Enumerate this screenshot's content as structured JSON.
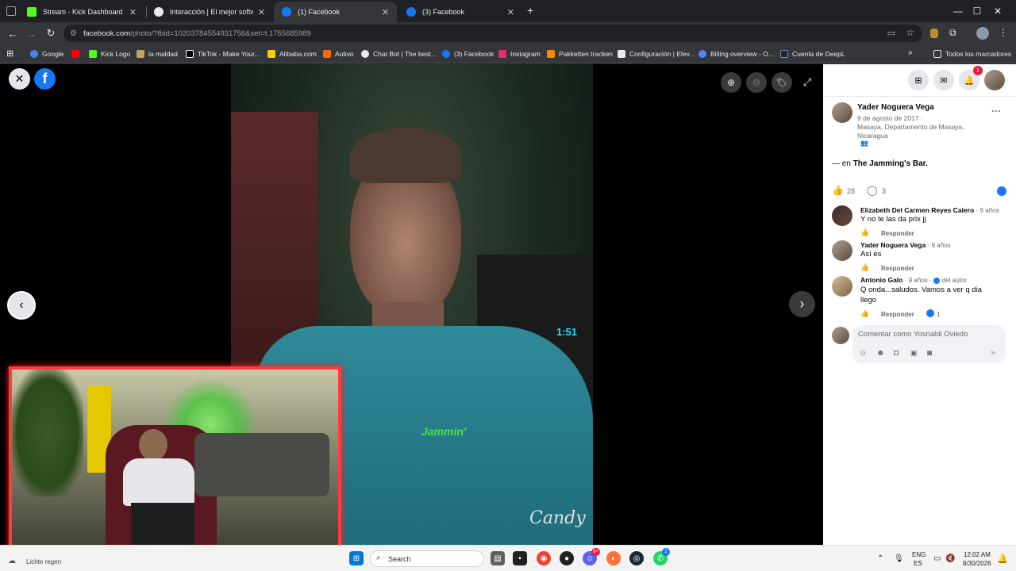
{
  "tabs": [
    {
      "title": "Stream - Kick Dashboard",
      "favicon_color": "#53fc18",
      "active": false
    },
    {
      "title": "Interacción | El mejor software p",
      "favicon_color": "#e8eaed",
      "active": false
    },
    {
      "title": "(1) Facebook",
      "favicon_color": "#1877f2",
      "active": true
    },
    {
      "title": "(3) Facebook",
      "favicon_color": "#1877f2",
      "active": false
    }
  ],
  "address": {
    "domain": "facebook.com",
    "path": "/photo/?fbid=10203784554931756&set=t.1755685989"
  },
  "bookmarks": [
    {
      "label": "Google",
      "icon_color": "#4285f4"
    },
    {
      "label": "Kick Logo",
      "icon_color": "#ff0000"
    },
    {
      "label": "la maldad",
      "icon_color": "#53fc18"
    },
    {
      "label": "TikTok - Make Your...",
      "icon_color": "#c8a060"
    },
    {
      "label": "Alibaba.com",
      "icon_color": "#ffcc00"
    },
    {
      "label": "Autivo",
      "icon_color": "#ff6a00"
    },
    {
      "label": "Chat Bot | The best...",
      "icon_color": "#e8eaed"
    },
    {
      "label": "(3) Facebook",
      "icon_color": "#1877f2"
    },
    {
      "label": "Instagram",
      "icon_color": "#e1306c"
    },
    {
      "label": "Pakketten tracken",
      "icon_color": "#ff8800"
    },
    {
      "label": "Configuración | Elev...",
      "icon_color": "#e8eaed"
    },
    {
      "label": "Billing overview - O...",
      "icon_color": "#4a8af4"
    },
    {
      "label": "Cuenta de DeepL",
      "icon_color": "#0f2b46"
    }
  ],
  "all_bookmarks_label": "Todos los marcadores",
  "post": {
    "author": "Yader Noguera Vega",
    "date": "9 de agosto de 2017 ·",
    "location": "Masaya, Departamento de Masaya, Nicaragua",
    "caption_prefix": "— en ",
    "caption_place": "The Jamming's Bar.",
    "likes": "28",
    "comments_count": "3"
  },
  "comments": [
    {
      "name": "Elizabeth Del Carmen Reyes Calero",
      "time": "· 9 años",
      "text": "Y no te las da prix jj",
      "reply": "Responder"
    },
    {
      "name": "Yader Noguera Vega",
      "time": "· 9 años",
      "text": "Así es",
      "reply": "Responder"
    },
    {
      "name": "Antonio Galo",
      "time": "· 9 años ·",
      "author_badge": "del autor",
      "text": "Q onda...saludos. Vamos a ver q dia llego",
      "reply": "Responder",
      "reactions": "1"
    }
  ],
  "comment_box": {
    "placeholder": "Comentar como Yosnaldi Oviedo"
  },
  "notifications_badge": "1",
  "photo_watermark": "Candy",
  "shirt_text": "Jammin'",
  "taskbar": {
    "search_placeholder": "Search",
    "weather": "Lichte regen",
    "lang": "ENG",
    "lang2": "ES",
    "time": "12:02 AM",
    "date": "8/30/2026",
    "discord_badge": "9+",
    "whatsapp_badge": "2"
  }
}
